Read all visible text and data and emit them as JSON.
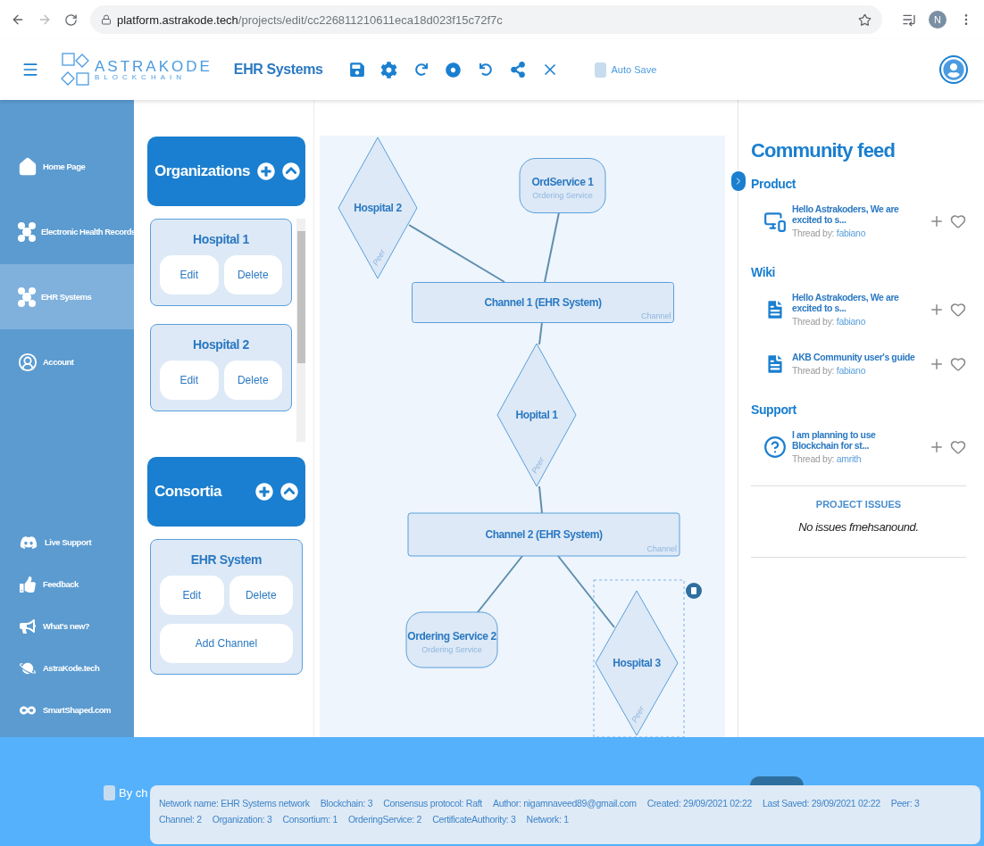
{
  "browser": {
    "url_domain": "platform.astrakode.tech",
    "url_path": "/projects/edit/cc226811210611eca18d023f15c72f7c",
    "profile_initial": "N"
  },
  "header": {
    "logo_title": "ASTRAKODE",
    "logo_subtitle": "BLOCKCHAIN",
    "project_title": "EHR Systems",
    "auto_save": {
      "label": "Auto Save",
      "checked": false
    }
  },
  "sidebar": {
    "items": [
      {
        "label": "Home Page",
        "selected": false
      },
      {
        "label": "Electronic Health Records",
        "selected": false
      },
      {
        "label": "EHR Systems",
        "selected": true
      },
      {
        "label": "Account",
        "selected": false
      }
    ],
    "bottom_items": [
      {
        "label": "Live Support"
      },
      {
        "label": "Feedback"
      },
      {
        "label": "What's new?"
      },
      {
        "label": "AstraKode.tech"
      },
      {
        "label": "SmartShaped.com"
      }
    ]
  },
  "organizations": {
    "title": "Organizations",
    "items": [
      {
        "name": "Hospital 1",
        "actions": [
          "Edit",
          "Delete"
        ]
      },
      {
        "name": "Hospital 2",
        "actions": [
          "Edit",
          "Delete"
        ]
      }
    ]
  },
  "consortia": {
    "title": "Consortia",
    "items": [
      {
        "name": "EHR System",
        "actions": [
          "Edit",
          "Delete"
        ],
        "extra_action": "Add Channel"
      }
    ]
  },
  "diagram": {
    "nodes": [
      {
        "kind": "peer",
        "label": "Hospital 2",
        "type_label": "Peer",
        "selected": false
      },
      {
        "kind": "orderer",
        "label": "OrdService 1",
        "type_label": "Ordering Service",
        "selected": false
      },
      {
        "kind": "channel",
        "label": "Channel 1 (EHR System)",
        "type_label": "Channel",
        "selected": false
      },
      {
        "kind": "peer",
        "label": "Hopital 1",
        "type_label": "Peer",
        "selected": false
      },
      {
        "kind": "channel",
        "label": "Channel 2 (EHR System)",
        "type_label": "Channel",
        "selected": false
      },
      {
        "kind": "orderer",
        "label": "Ordering Service 2",
        "type_label": "Ordering Service",
        "selected": false
      },
      {
        "kind": "peer",
        "label": "Hospital 3",
        "type_label": "Peer",
        "selected": true
      }
    ]
  },
  "feed": {
    "title": "Community feed",
    "sections": [
      {
        "title": "Product",
        "items": [
          {
            "kind": "product",
            "title": "Hello Astrakoders, We are excited to s...",
            "author_label": "Thread by:",
            "author": "fabiano"
          }
        ]
      },
      {
        "title": "Wiki",
        "items": [
          {
            "kind": "wiki",
            "title": "Hello Astrakoders, We are excited to s...",
            "author_label": "Thread by:",
            "author": "fabiano"
          },
          {
            "kind": "wiki",
            "title": "AKB Community user's guide",
            "author_label": "Thread by:",
            "author": "fabiano"
          }
        ]
      },
      {
        "title": "Support",
        "items": [
          {
            "kind": "question",
            "title": "I am planning to use Blockchain for st...",
            "author_label": "Thread by:",
            "author": "amrith"
          }
        ]
      }
    ],
    "issues": {
      "title": "PROJECT ISSUES",
      "message": "No issues fmehsanound."
    }
  },
  "footer": {
    "terms_label": "By ch",
    "terms_checked": false,
    "info": [
      "Network name: EHR Systems network",
      "Blockchain: 3",
      "Consensus protocol: Raft",
      "Author: nigamnaveed89@gmail.com",
      "Created: 29/09/2021 02:22",
      "Last Saved: 29/09/2021 02:22",
      "Peer: 3",
      "Channel: 2",
      "Organization: 3",
      "Consortium: 1",
      "OrderingService: 2",
      "CertificateAuthority: 3",
      "Network: 1"
    ]
  }
}
